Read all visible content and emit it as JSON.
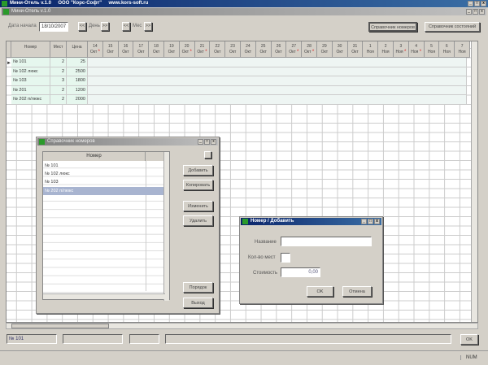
{
  "app": {
    "title": "Мини-Отель v.1.0",
    "company": "ООО \"Корс-Софт\"",
    "site": "www.kors-soft.ru",
    "inner_title": "Мини-Отель v.1.0"
  },
  "toolbar": {
    "date_label": "Дата начала",
    "date_value": "18/10/2007",
    "day_prev": "<<",
    "day_label": "День",
    "day_next": ">>",
    "month_prev": "<<",
    "month_label": "Мес",
    "month_next": ">>",
    "rooms_ref": "Справочник номеров",
    "states_ref": "Справочник состояний"
  },
  "grid": {
    "headers": {
      "room": "Номер",
      "places": "Мест",
      "price": "Цена"
    },
    "dates": [
      {
        "d": "14",
        "m": "Окт",
        "mark": true
      },
      {
        "d": "15",
        "m": "Окт"
      },
      {
        "d": "16",
        "m": "Окт"
      },
      {
        "d": "17",
        "m": "Окт"
      },
      {
        "d": "18",
        "m": "Окт"
      },
      {
        "d": "19",
        "m": "Окт"
      },
      {
        "d": "20",
        "m": "Окт",
        "mark": true
      },
      {
        "d": "21",
        "m": "Окт",
        "mark": true
      },
      {
        "d": "22",
        "m": "Окт"
      },
      {
        "d": "23",
        "m": "Окт"
      },
      {
        "d": "24",
        "m": "Окт"
      },
      {
        "d": "25",
        "m": "Окт"
      },
      {
        "d": "26",
        "m": "Окт"
      },
      {
        "d": "27",
        "m": "Окт",
        "mark": true
      },
      {
        "d": "28",
        "m": "Окт",
        "mark": true
      },
      {
        "d": "29",
        "m": "Окт"
      },
      {
        "d": "30",
        "m": "Окт"
      },
      {
        "d": "31",
        "m": "Окт"
      },
      {
        "d": "1",
        "m": "Ноя"
      },
      {
        "d": "2",
        "m": "Ноя"
      },
      {
        "d": "3",
        "m": "Ноя",
        "mark": true
      },
      {
        "d": "4",
        "m": "Ноя",
        "mark": true
      },
      {
        "d": "5",
        "m": "Ноя"
      },
      {
        "d": "6",
        "m": "Ноя"
      },
      {
        "d": "7",
        "m": "Ноя"
      }
    ],
    "mark_symbol": "*",
    "rows": [
      {
        "room": "№ 101",
        "places": "2",
        "price": "25"
      },
      {
        "room": "№ 102 люкс",
        "places": "2",
        "price": "2500"
      },
      {
        "room": "№ 103",
        "places": "3",
        "price": "1800"
      },
      {
        "room": "№ 201",
        "places": "2",
        "price": "1200"
      },
      {
        "room": "№ 202 п/люкс",
        "places": "2",
        "price": "2000"
      }
    ]
  },
  "status": {
    "current": "№ 101",
    "ok": "OK",
    "num": "NUM"
  },
  "rooms_dialog": {
    "title": "Справочник номеров",
    "col": "Номер",
    "items": [
      "№ 101",
      "№ 102 люкс",
      "№ 103",
      "№ 202 п/люкс"
    ],
    "selected": 3,
    "add": "Добавить",
    "copy": "Копировать",
    "edit": "Изменить",
    "delete": "Удалить",
    "order": "Порядок",
    "exit": "Выход"
  },
  "add_dialog": {
    "title": "Номер / Добавить",
    "name_label": "Название",
    "name_value": "",
    "places_label": "Кол-во мест",
    "places_value": "",
    "cost_label": "Стоимость",
    "cost_value": "0,00",
    "ok": "OK",
    "cancel": "Отмена"
  }
}
